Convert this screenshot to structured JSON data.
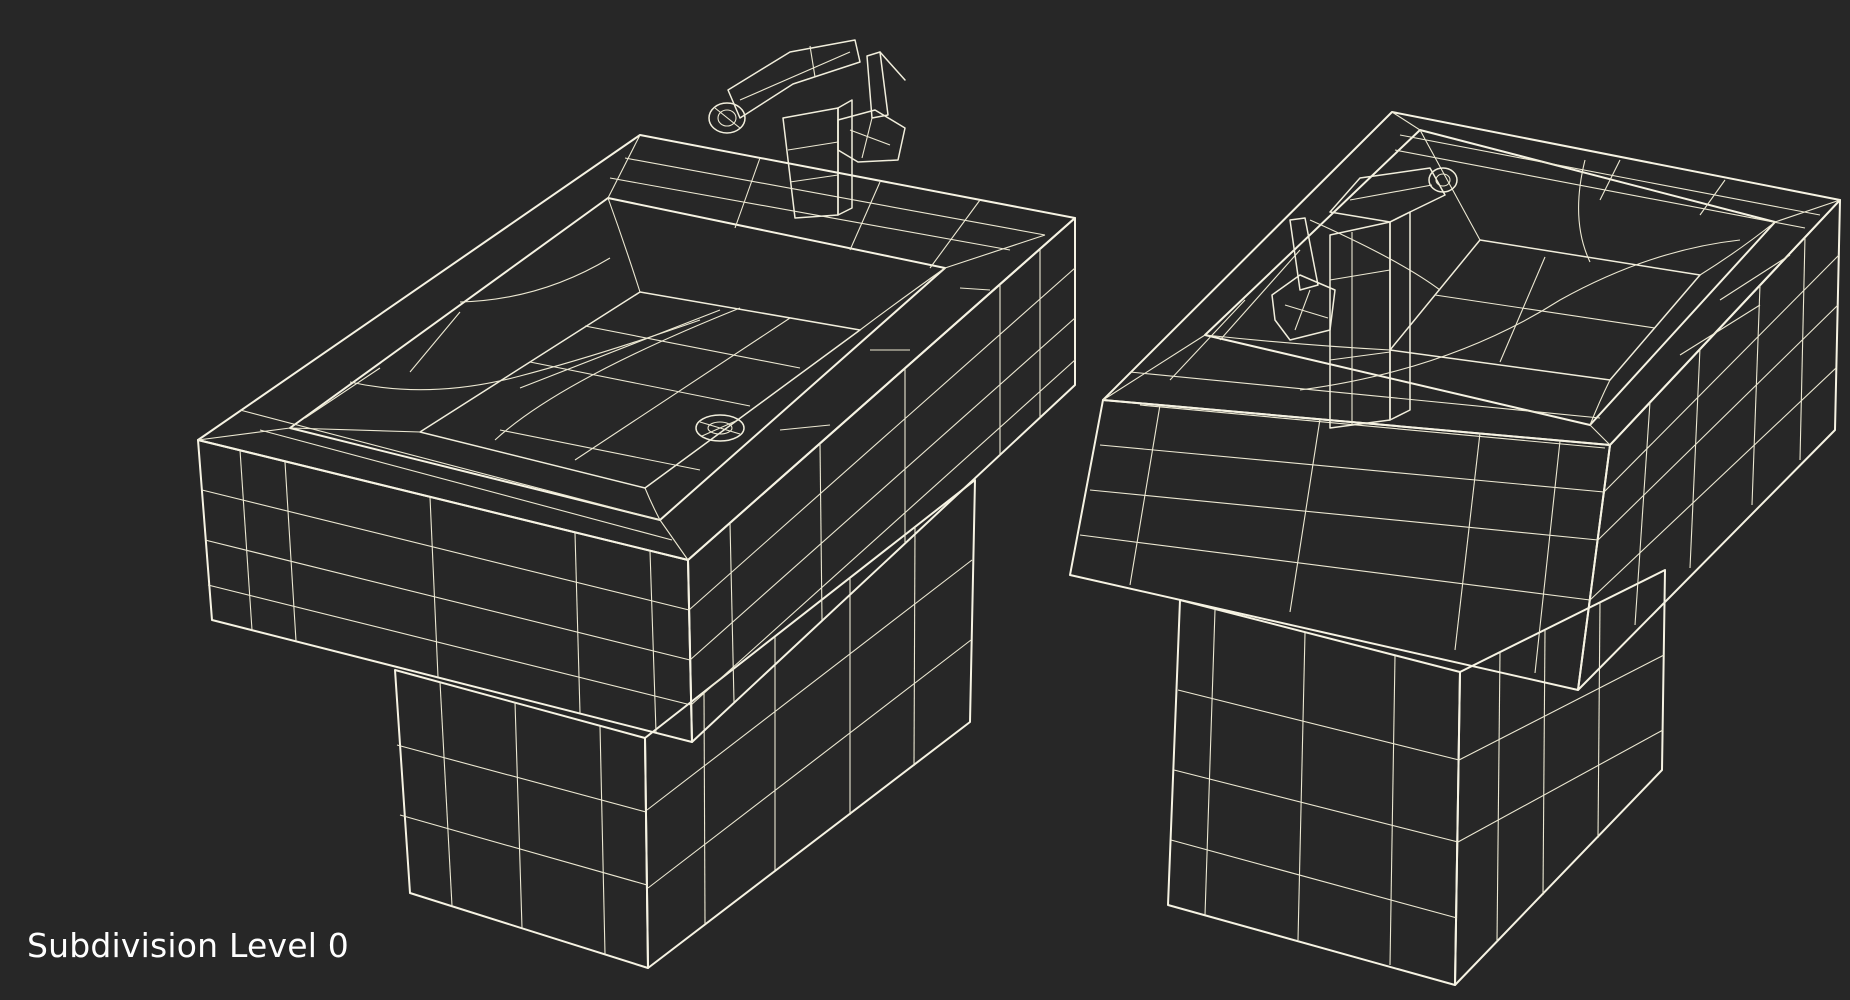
{
  "viewport": {
    "background_color": "#272727",
    "surface_color": "#7a7a6e",
    "wire_color": "#f1eedc"
  },
  "caption": {
    "text": "Subdivision Level 0"
  },
  "objects": [
    {
      "name": "bidet-front-view"
    },
    {
      "name": "bidet-back-view"
    }
  ]
}
